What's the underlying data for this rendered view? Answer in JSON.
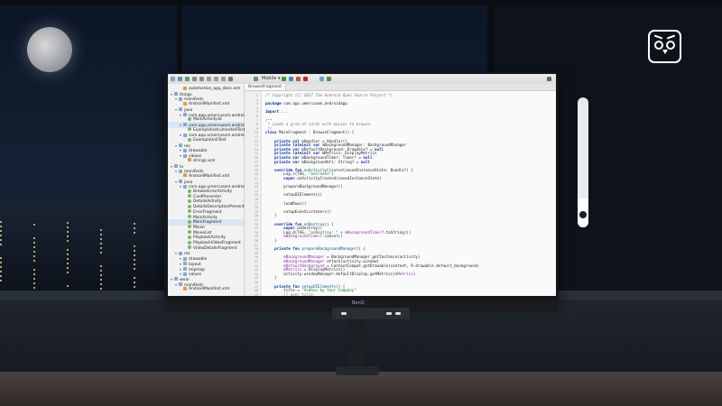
{
  "brand": {
    "monitor_logo": "BenQ"
  },
  "widgets": {
    "brightness_level": 0.22
  },
  "ide": {
    "editor_tab": "BrowseFragment",
    "toolbar_run_label": "Mobile ▾",
    "project_tree": [
      {
        "label": "automotive_app_desc.xml",
        "type": "xml",
        "depth": 2
      },
      {
        "label": "things",
        "type": "folder",
        "depth": 0
      },
      {
        "label": "manifests",
        "type": "folder",
        "depth": 1
      },
      {
        "label": "AndroidManifest.xml",
        "type": "xml",
        "depth": 2
      },
      {
        "label": "java",
        "type": "folder",
        "depth": 1
      },
      {
        "label": "com.app.umercusom.androidapp",
        "type": "folder",
        "depth": 2
      },
      {
        "label": "MainActivity.kt",
        "type": "file",
        "depth": 3
      },
      {
        "label": "com.app.umercusom.androidapp",
        "type": "folder",
        "depth": 2,
        "selected": true
      },
      {
        "label": "ExampleInstrumentedTest",
        "type": "file",
        "depth": 3
      },
      {
        "label": "com.app.umercusom.androidapp",
        "type": "folder",
        "depth": 2
      },
      {
        "label": "ExampleUnitTest",
        "type": "file",
        "depth": 3
      },
      {
        "label": "res",
        "type": "folder",
        "depth": 1
      },
      {
        "label": "drawable",
        "type": "folder",
        "depth": 2
      },
      {
        "label": "values",
        "type": "folder",
        "depth": 2
      },
      {
        "label": "strings.xml",
        "type": "xml",
        "depth": 3
      },
      {
        "label": "tv",
        "type": "folder",
        "depth": 0
      },
      {
        "label": "manifests",
        "type": "folder",
        "depth": 1
      },
      {
        "label": "AndroidManifest.xml",
        "type": "xml",
        "depth": 2
      },
      {
        "label": "java",
        "type": "folder",
        "depth": 1
      },
      {
        "label": "com.app.umercusom.androidapp",
        "type": "folder",
        "depth": 2
      },
      {
        "label": "BrowseErrorActivity",
        "type": "file",
        "depth": 3
      },
      {
        "label": "CardPresenter",
        "type": "file",
        "depth": 3
      },
      {
        "label": "DetailsActivity",
        "type": "file",
        "depth": 3
      },
      {
        "label": "DetailsDescriptionPresenter",
        "type": "file",
        "depth": 3
      },
      {
        "label": "ErrorFragment",
        "type": "file",
        "depth": 3
      },
      {
        "label": "MainActivity",
        "type": "file",
        "depth": 3
      },
      {
        "label": "MainFragment",
        "type": "file",
        "depth": 3,
        "selected": true
      },
      {
        "label": "Movie",
        "type": "file",
        "depth": 3
      },
      {
        "label": "MovieList",
        "type": "file",
        "depth": 3
      },
      {
        "label": "PlaybackActivity",
        "type": "file",
        "depth": 3
      },
      {
        "label": "PlaybackVideoFragment",
        "type": "file",
        "depth": 3
      },
      {
        "label": "VideoDetailsFragment",
        "type": "file",
        "depth": 3
      },
      {
        "label": "res",
        "type": "folder",
        "depth": 1
      },
      {
        "label": "drawable",
        "type": "folder",
        "depth": 2
      },
      {
        "label": "layout",
        "type": "folder",
        "depth": 2
      },
      {
        "label": "mipmap",
        "type": "folder",
        "depth": 2
      },
      {
        "label": "values",
        "type": "folder",
        "depth": 2
      },
      {
        "label": "wear",
        "type": "folder",
        "depth": 0
      },
      {
        "label": "manifests",
        "type": "folder",
        "depth": 1
      },
      {
        "label": "AndroidManifest.xml",
        "type": "xml",
        "depth": 2
      }
    ],
    "code_lines": [
      {
        "n": "1",
        "segments": [
          {
            "t": "/* Copyright (C) 2017 The Android Open Source Project */",
            "c": "cm"
          }
        ]
      },
      {
        "n": "2",
        "segments": []
      },
      {
        "n": "3",
        "segments": [
          {
            "t": "package",
            "c": "kw"
          },
          {
            "t": " com.app.umercusom.androidapp",
            "c": ""
          }
        ]
      },
      {
        "n": "4",
        "segments": []
      },
      {
        "n": "5",
        "segments": [
          {
            "t": "import",
            "c": "kw"
          },
          {
            "t": " ...",
            "c": ""
          }
        ]
      },
      {
        "n": "6",
        "segments": []
      },
      {
        "n": "7",
        "segments": [
          {
            "t": "/**",
            "c": "cm"
          }
        ]
      },
      {
        "n": "8",
        "segments": [
          {
            "t": " * Loads a grid of cards with movies to browse.",
            "c": "cm"
          }
        ]
      },
      {
        "n": "9",
        "segments": [
          {
            "t": " */",
            "c": "cm"
          }
        ]
      },
      {
        "n": "10",
        "segments": [
          {
            "t": "class",
            "c": "kw"
          },
          {
            "t": " MainFragment : BrowseFragment() {",
            "c": ""
          }
        ]
      },
      {
        "n": "11",
        "segments": []
      },
      {
        "n": "12",
        "segments": [
          {
            "t": "    private val",
            "c": "kw"
          },
          {
            "t": " mHandler = Handler()",
            "c": ""
          }
        ]
      },
      {
        "n": "13",
        "segments": [
          {
            "t": "    private lateinit var",
            "c": "kw"
          },
          {
            "t": " mBackgroundManager: BackgroundManager",
            "c": ""
          }
        ]
      },
      {
        "n": "14",
        "segments": [
          {
            "t": "    private var",
            "c": "kw"
          },
          {
            "t": " mDefaultBackground: Drawable? = ",
            "c": ""
          },
          {
            "t": "null",
            "c": "kw"
          }
        ]
      },
      {
        "n": "15",
        "segments": [
          {
            "t": "    private lateinit var",
            "c": "kw"
          },
          {
            "t": " mMetrics: DisplayMetrics",
            "c": ""
          }
        ]
      },
      {
        "n": "16",
        "segments": [
          {
            "t": "    private var",
            "c": "kw"
          },
          {
            "t": " mBackgroundTimer: Timer? = ",
            "c": ""
          },
          {
            "t": "null",
            "c": "kw"
          }
        ]
      },
      {
        "n": "17",
        "segments": [
          {
            "t": "    private var",
            "c": "kw"
          },
          {
            "t": " mBackgroundUri: String? = ",
            "c": ""
          },
          {
            "t": "null",
            "c": "kw"
          }
        ]
      },
      {
        "n": "18",
        "segments": []
      },
      {
        "n": "19",
        "segments": [
          {
            "t": "    override fun",
            "c": "kw"
          },
          {
            "t": " onActivityCreated",
            "c": "fn"
          },
          {
            "t": "(savedInstanceState: Bundle?) {",
            "c": ""
          }
        ]
      },
      {
        "n": "20",
        "segments": [
          {
            "t": "        Log.i(TAG, ",
            "c": ""
          },
          {
            "t": "\"onCreate\"",
            "c": "str"
          },
          {
            "t": ")",
            "c": ""
          }
        ]
      },
      {
        "n": "21",
        "segments": [
          {
            "t": "        super",
            "c": "kw"
          },
          {
            "t": ".onActivityCreated(savedInstanceState)",
            "c": ""
          }
        ]
      },
      {
        "n": "22",
        "segments": []
      },
      {
        "n": "23",
        "segments": [
          {
            "t": "        prepareBackgroundManager()",
            "c": ""
          }
        ]
      },
      {
        "n": "24",
        "segments": []
      },
      {
        "n": "25",
        "segments": [
          {
            "t": "        setupUIElements()",
            "c": ""
          }
        ]
      },
      {
        "n": "26",
        "segments": []
      },
      {
        "n": "27",
        "segments": [
          {
            "t": "        loadRows()",
            "c": ""
          }
        ]
      },
      {
        "n": "28",
        "segments": []
      },
      {
        "n": "29",
        "segments": [
          {
            "t": "        setupEventListeners()",
            "c": ""
          }
        ]
      },
      {
        "n": "30",
        "segments": [
          {
            "t": "    }",
            "c": ""
          }
        ]
      },
      {
        "n": "31",
        "segments": []
      },
      {
        "n": "32",
        "segments": [
          {
            "t": "    override fun",
            "c": "kw"
          },
          {
            "t": " onDestroy",
            "c": "fn"
          },
          {
            "t": "() {",
            "c": ""
          }
        ]
      },
      {
        "n": "33",
        "segments": [
          {
            "t": "        super",
            "c": "kw"
          },
          {
            "t": ".onDestroy()",
            "c": ""
          }
        ]
      },
      {
        "n": "34",
        "segments": [
          {
            "t": "        Log.d(TAG, ",
            "c": ""
          },
          {
            "t": "\"onDestroy: \"",
            "c": "str"
          },
          {
            "t": " + ",
            "c": ""
          },
          {
            "t": "mBackgroundTimer",
            "c": "field"
          },
          {
            "t": "?.toString())",
            "c": ""
          }
        ]
      },
      {
        "n": "35",
        "segments": [
          {
            "t": "        mBackgroundTimer",
            "c": "field"
          },
          {
            "t": "?.cancel()",
            "c": ""
          }
        ]
      },
      {
        "n": "36",
        "segments": [
          {
            "t": "    }",
            "c": ""
          }
        ]
      },
      {
        "n": "37",
        "segments": []
      },
      {
        "n": "38",
        "segments": [
          {
            "t": "    private fun",
            "c": "kw"
          },
          {
            "t": " prepareBackgroundManager",
            "c": "fn"
          },
          {
            "t": "() {",
            "c": ""
          }
        ]
      },
      {
        "n": "39",
        "segments": []
      },
      {
        "n": "40",
        "segments": [
          {
            "t": "        mBackgroundManager",
            "c": "field"
          },
          {
            "t": " = BackgroundManager.getInstance(activity)",
            "c": ""
          }
        ]
      },
      {
        "n": "41",
        "segments": [
          {
            "t": "        mBackgroundManager",
            "c": "field"
          },
          {
            "t": ".attach(activity.window)",
            "c": ""
          }
        ]
      },
      {
        "n": "42",
        "segments": [
          {
            "t": "        mDefaultBackground",
            "c": "field"
          },
          {
            "t": " = ContextCompat.getDrawable(context, R.drawable.default_background)",
            "c": ""
          }
        ]
      },
      {
        "n": "43",
        "segments": [
          {
            "t": "        mMetrics",
            "c": "field"
          },
          {
            "t": " = DisplayMetrics()",
            "c": ""
          }
        ]
      },
      {
        "n": "44",
        "segments": [
          {
            "t": "        activity.windowManager.defaultDisplay.getMetrics(",
            "c": ""
          },
          {
            "t": "mMetrics",
            "c": "field"
          },
          {
            "t": ")",
            "c": ""
          }
        ]
      },
      {
        "n": "45",
        "segments": [
          {
            "t": "    }",
            "c": ""
          }
        ]
      },
      {
        "n": "46",
        "segments": []
      },
      {
        "n": "47",
        "segments": [
          {
            "t": "    private fun",
            "c": "kw"
          },
          {
            "t": " setupUIElements",
            "c": "fn"
          },
          {
            "t": "() {",
            "c": ""
          }
        ]
      },
      {
        "n": "48",
        "segments": [
          {
            "t": "        title = ",
            "c": ""
          },
          {
            "t": "\"Videos by Your Company\"",
            "c": "str"
          }
        ]
      },
      {
        "n": "49",
        "segments": [
          {
            "t": "        // over title",
            "c": "cm"
          }
        ]
      }
    ]
  }
}
